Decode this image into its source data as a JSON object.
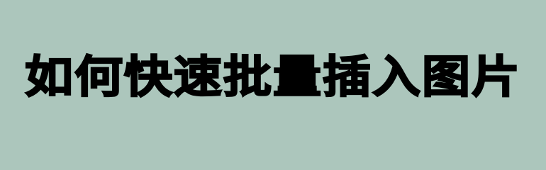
{
  "banner": {
    "title": "如何快速批量插入图片",
    "background_color": "#acc6bc",
    "text_color": "#000000"
  }
}
